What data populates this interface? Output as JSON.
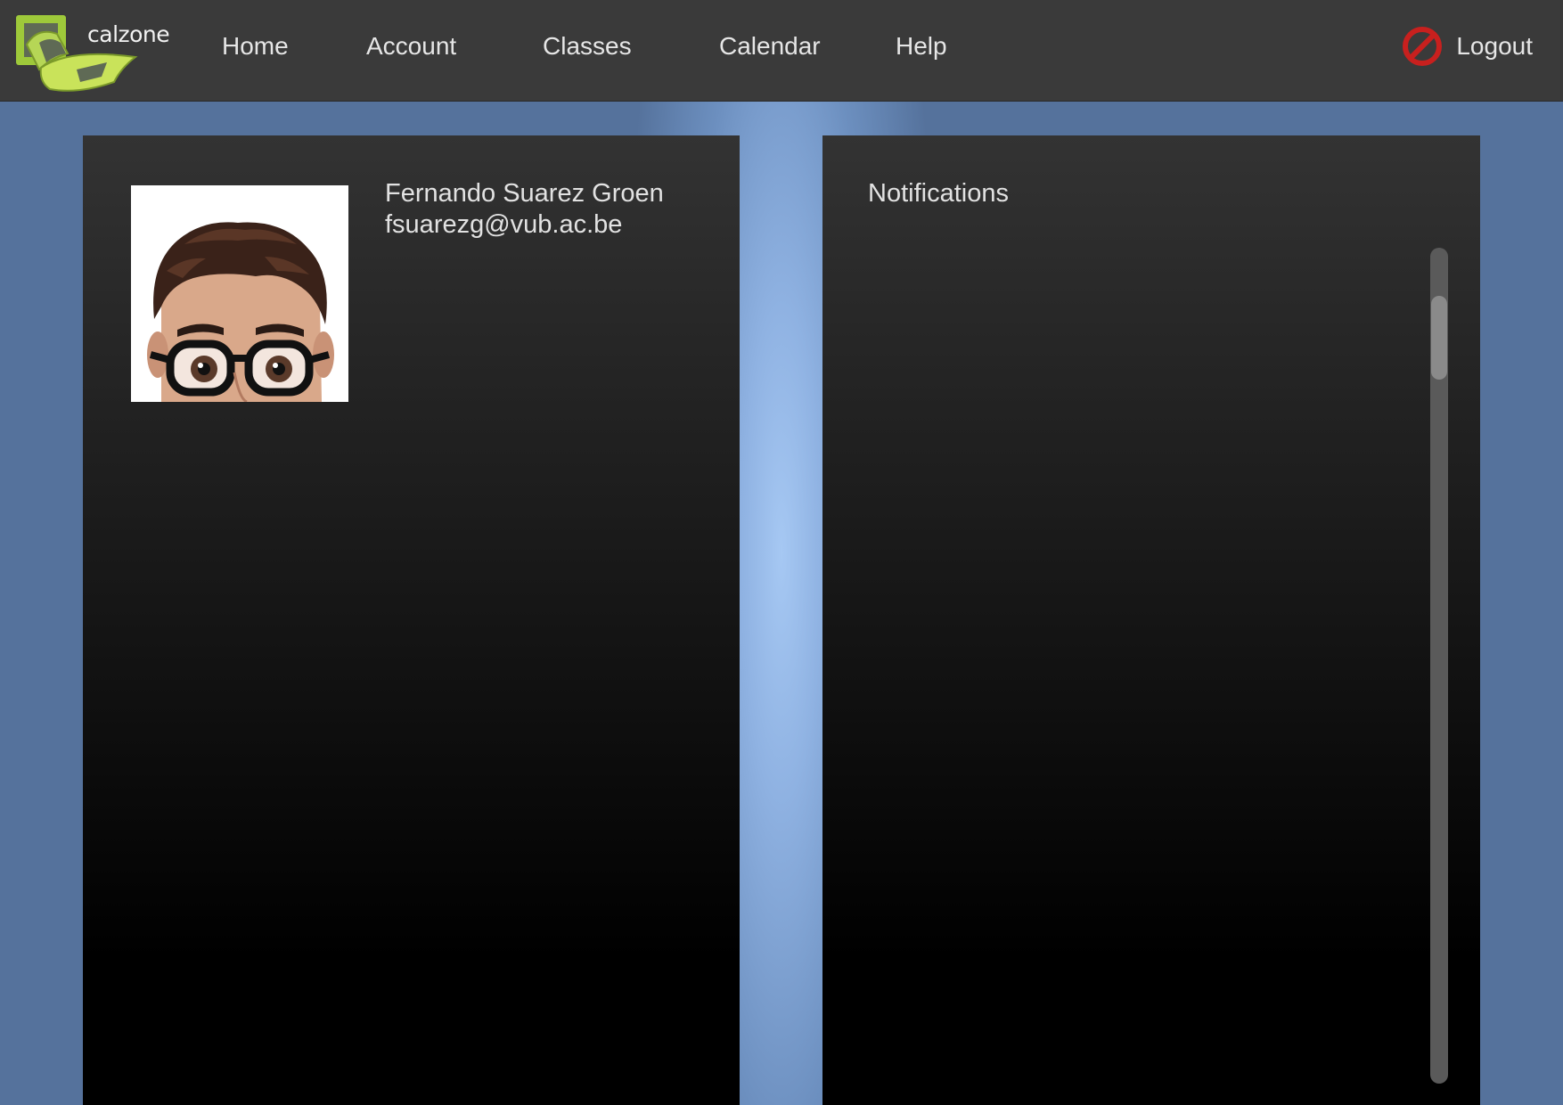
{
  "app": {
    "logo_text": "calzone"
  },
  "nav": {
    "items": [
      {
        "label": "Home"
      },
      {
        "label": "Account"
      },
      {
        "label": "Classes"
      },
      {
        "label": "Calendar"
      },
      {
        "label": "Help"
      }
    ],
    "logout_label": "Logout",
    "logout_icon": "no-entry-icon"
  },
  "profile": {
    "name": "Fernando Suarez Groen",
    "email": "fsuarezg@vub.ac.be"
  },
  "notifications": {
    "title": "Notifications"
  },
  "colors": {
    "topbar": "#3a3a3a",
    "logo_green": "#9ec93a",
    "logout_red": "#c8201e",
    "background_blue": "#55729c"
  }
}
